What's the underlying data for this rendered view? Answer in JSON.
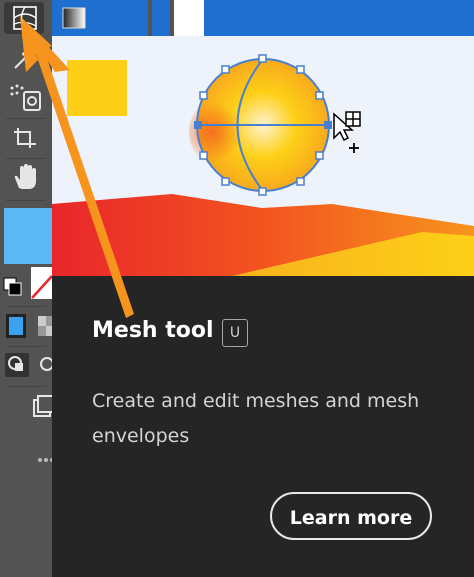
{
  "tooltip": {
    "title": "Mesh tool",
    "shortcut": "U",
    "description": "Create and edit meshes and mesh envelopes",
    "learn_more_label": "Learn more"
  },
  "toolbar": {
    "tools": [
      {
        "icon": "mesh-icon",
        "selected": true
      },
      {
        "icon": "gradient-icon"
      },
      {
        "icon": "eyedropper-icon"
      },
      {
        "icon": "symbol-sprayer-icon"
      },
      {
        "icon": "artboard-icon"
      },
      {
        "icon": "hand-icon"
      },
      {
        "icon": "fill-swatch-icon"
      },
      {
        "icon": "default-colors-icon"
      },
      {
        "icon": "none-color-icon"
      },
      {
        "icon": "color-mode-icon"
      },
      {
        "icon": "gradient-mode-icon"
      },
      {
        "icon": "draw-normal-icon"
      },
      {
        "icon": "draw-inside-icon"
      },
      {
        "icon": "screen-mode-icon"
      },
      {
        "icon": "more-tools-icon"
      }
    ],
    "fill_color": "#5bb8f5"
  },
  "colors": {
    "accent_arrow": "#f7941d",
    "panel_bg": "#252525",
    "top_bar": "#1f6fd1",
    "sun_yellow": "#fdd017",
    "sun_orange": "#f77d1e",
    "mountain_red": "#e8262b"
  }
}
